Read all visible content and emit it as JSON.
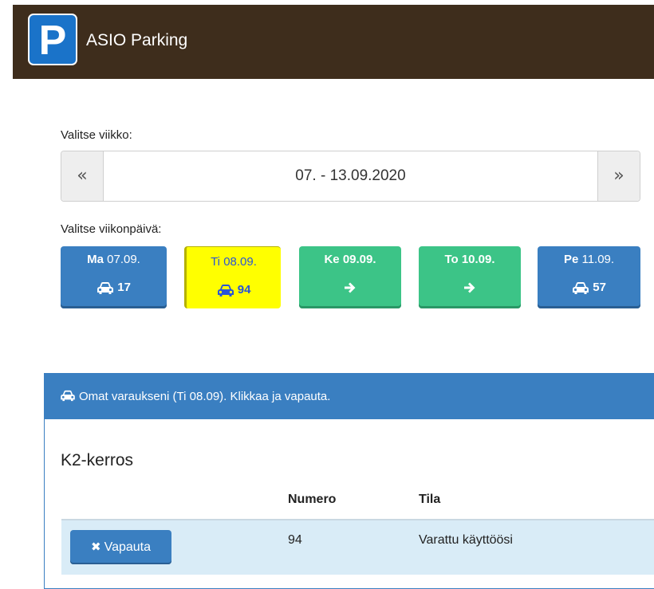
{
  "app": {
    "logo_letter": "P",
    "title": "ASIO Parking"
  },
  "week": {
    "label": "Valitse viikko:",
    "prev": "«",
    "range": "07. - 13.09.2020",
    "next": "»"
  },
  "weekday": {
    "label": "Valitse viikonpäivä:",
    "days": [
      {
        "abbr": "Ma",
        "date": "07.09.",
        "count": "17",
        "icon": "car-icon",
        "state": "available",
        "color": "#3a7fc1"
      },
      {
        "abbr": "Ti",
        "date": "08.09.",
        "count": "94",
        "icon": "car-icon",
        "state": "selected",
        "color": "#ffff00"
      },
      {
        "abbr": "Ke",
        "date": "09.09.",
        "count": "",
        "icon": "arrow-right-icon",
        "state": "free",
        "color": "#3cc487"
      },
      {
        "abbr": "To",
        "date": "10.09.",
        "count": "",
        "icon": "arrow-right-icon",
        "state": "free",
        "color": "#3cc487"
      },
      {
        "abbr": "Pe",
        "date": "11.09.",
        "count": "57",
        "icon": "car-icon",
        "state": "available",
        "color": "#3a7fc1"
      }
    ]
  },
  "reservations": {
    "heading": "Omat varaukseni (Ti 08.09). Klikkaa ja vapauta.",
    "section": "K2-kerros",
    "columns": [
      "",
      "Numero",
      "Tila"
    ],
    "rows": [
      {
        "button": "Vapauta",
        "number": "94",
        "status": "Varattu käyttöösi"
      }
    ]
  },
  "colors": {
    "navbar": "#3e2d1c",
    "primary": "#3a7fc1",
    "success": "#3cc487",
    "selected": "#ffff00",
    "row_highlight": "#d9ecf7"
  }
}
